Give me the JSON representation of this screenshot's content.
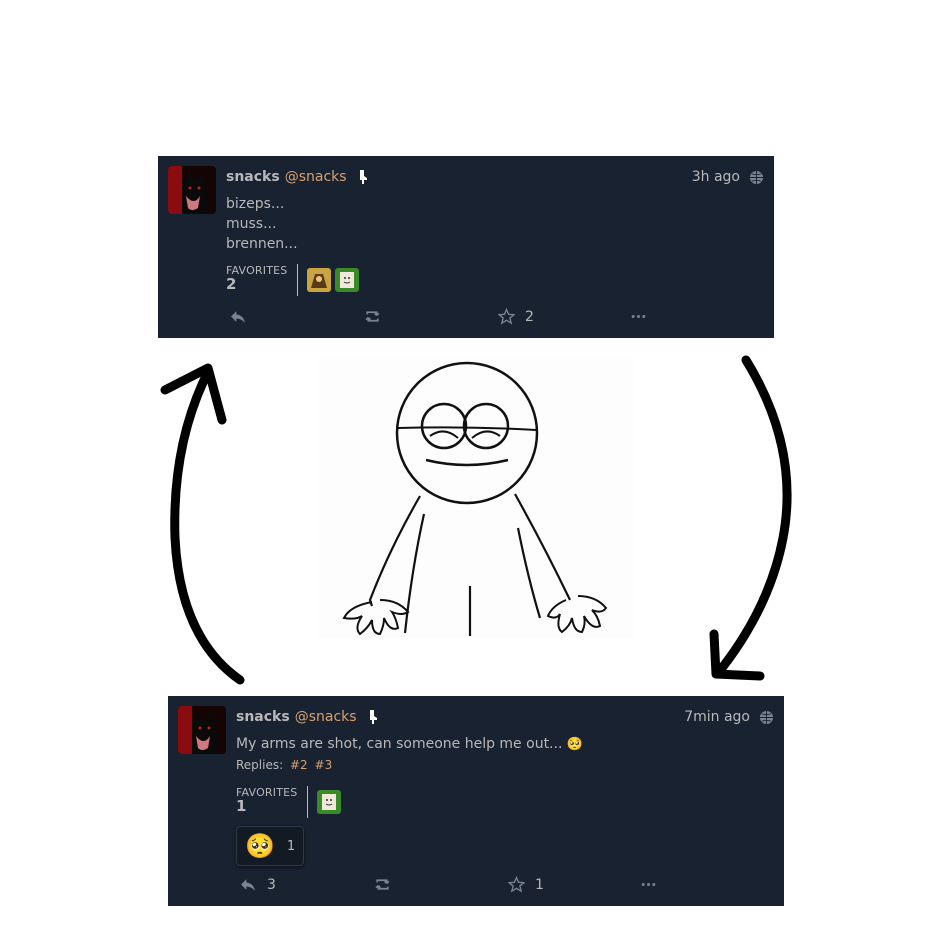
{
  "colors": {
    "panel_bg": "#182230",
    "text": "#b9b9ba",
    "link": "#d8a070"
  },
  "post1": {
    "display_name": "snacks",
    "handle": "@snacks",
    "time": "3h ago",
    "lines": [
      "bizeps...",
      "muss...",
      "brennen..."
    ],
    "favorites_label": "FAVORITES",
    "favorites_count": "2",
    "actions": {
      "reply_count": "",
      "repeat_count": "",
      "favorite_count": "2"
    },
    "icons": [
      "avatar-wolf",
      "bot-icon",
      "globe-icon",
      "reply-icon",
      "retweet-icon",
      "star-icon",
      "ellipsis-icon"
    ]
  },
  "post2": {
    "display_name": "snacks",
    "handle": "@snacks",
    "time": "7min ago",
    "text": "My arms are shot, can someone help me out... ",
    "emoji": "🥺",
    "replies_label": "Replies:",
    "replies": [
      "#2",
      "#3"
    ],
    "favorites_label": "FAVORITES",
    "favorites_count": "1",
    "reaction_emoji": "🥺",
    "reaction_count": "1",
    "actions": {
      "reply_count": "3",
      "repeat_count": "",
      "favorite_count": "1"
    }
  }
}
